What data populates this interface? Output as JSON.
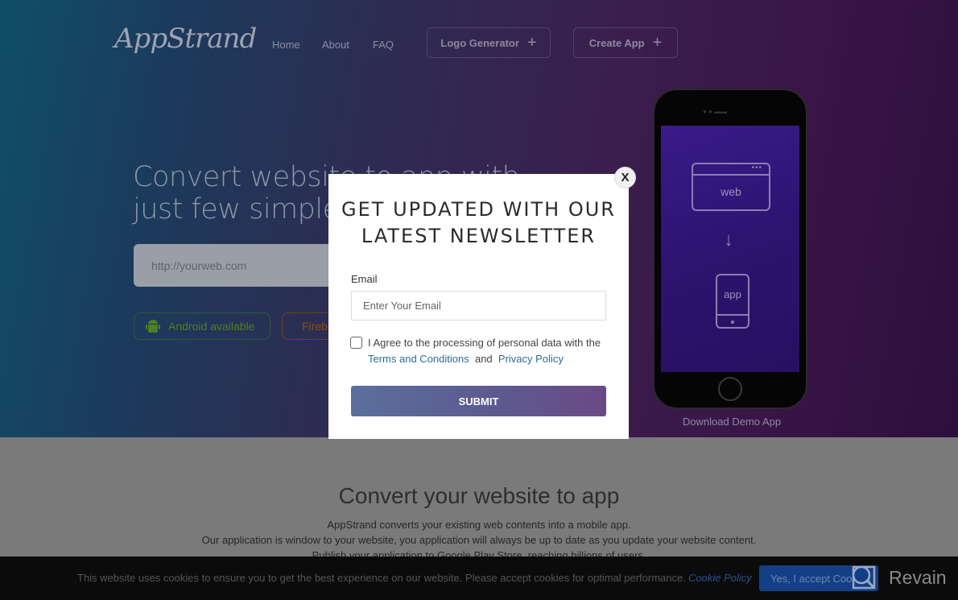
{
  "header": {
    "logo": "AppStrand",
    "nav": [
      "Home",
      "About",
      "FAQ"
    ],
    "buttons": [
      {
        "label": "Logo Generator",
        "icon": "plus-icon"
      },
      {
        "label": "Create App",
        "icon": "plus-icon"
      }
    ]
  },
  "hero": {
    "title_line1": "Convert website to app with",
    "title_line2": "just few simple clicks",
    "url_placeholder": "http://yourweb.com",
    "badges": [
      {
        "label": "Android available",
        "icon": "android-icon"
      },
      {
        "label": "Firebase",
        "icon": "firebase-icon"
      }
    ],
    "phone": {
      "web_label": "web",
      "app_label": "app",
      "arrow": "↓"
    },
    "download_label": "Download Demo App"
  },
  "section": {
    "title": "Convert your website to app",
    "lines": [
      "AppStrand converts your existing web contents into a mobile app.",
      "Our application is window to your website, you application will always be up to date as you update your website content.",
      "Publish your application to Google Play Store, reaching billions of users."
    ]
  },
  "modal": {
    "close_label": "X",
    "title_line1": "GET UPDATED WITH OUR",
    "title_line2": "LATEST NEWSLETTER",
    "email_label": "Email",
    "email_placeholder": "Enter Your Email",
    "agree_prefix": "I Agree to the processing of personal data with the",
    "terms_link": "Terms and Conditions",
    "and": "and",
    "privacy_link": "Privacy Policy",
    "submit_label": "SUBMIT"
  },
  "cookie": {
    "text": "This website uses cookies to ensure you to get the best experience on our website. Please accept cookies for optimal performance.",
    "policy_link": "Cookie Policy",
    "accept_label": "Yes, I accept Cookies"
  },
  "watermark": {
    "text": "Revain"
  }
}
